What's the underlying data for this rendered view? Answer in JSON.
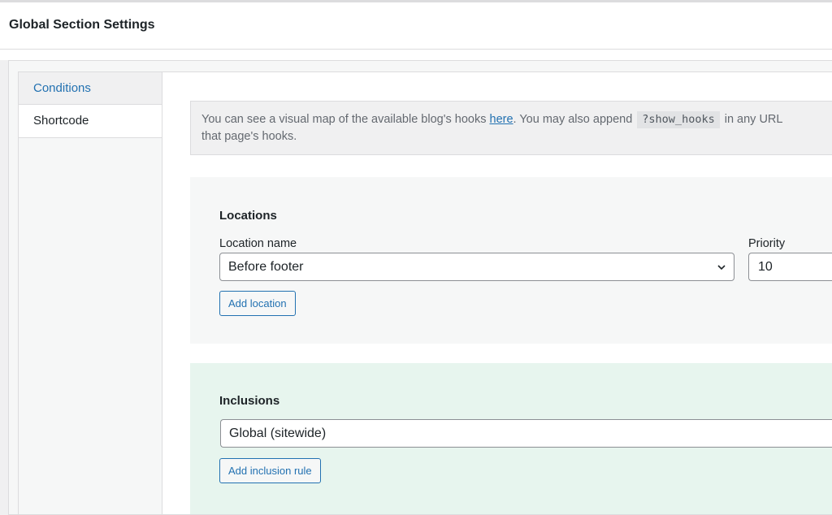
{
  "panel": {
    "title": "Global Section Settings"
  },
  "tabs": [
    {
      "label": "Conditions",
      "active": true
    },
    {
      "label": "Shortcode",
      "active": false
    }
  ],
  "notice": {
    "text_before": "You can see a visual map of the available blog's hooks ",
    "link_text": "here",
    "text_middle": ". You may also append ",
    "code": "?show_hooks",
    "text_after": " in any URL",
    "line2": "that page's hooks."
  },
  "locations": {
    "heading": "Locations",
    "location_label": "Location name",
    "location_value": "Before footer",
    "priority_label": "Priority",
    "priority_value": "10",
    "add_button": "Add location"
  },
  "inclusions": {
    "heading": "Inclusions",
    "rule_value": "Global (sitewide)",
    "add_button": "Add inclusion rule"
  },
  "colors": {
    "accent": "#2271b1",
    "inclusions_bg": "#e7f5ee",
    "locations_bg": "#f6f7f7"
  },
  "icons": {
    "select_arrow": "chevron-down-icon"
  }
}
